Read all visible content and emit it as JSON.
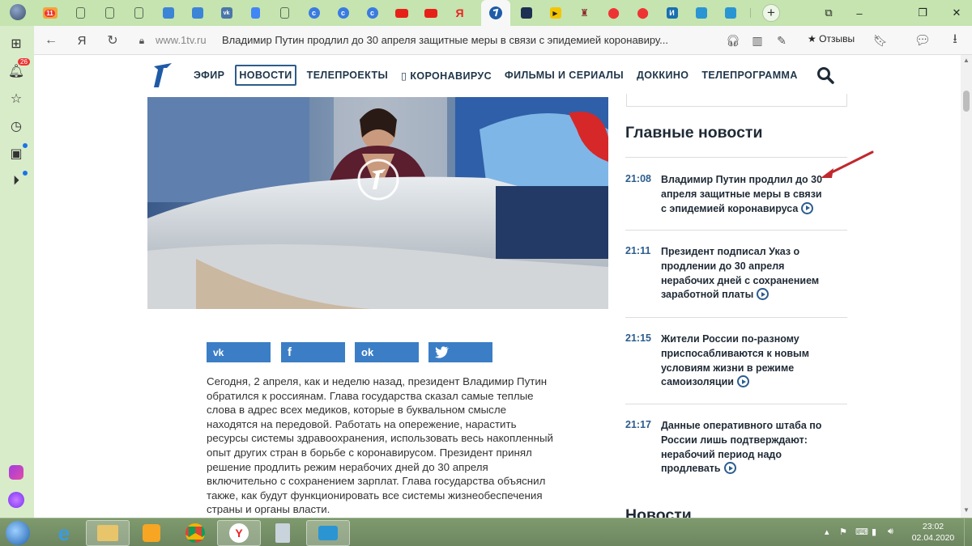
{
  "browser": {
    "tab_badge": "11",
    "tab_letter_ya": "Я",
    "new_tab_glyph": "+",
    "notifications_badge": "26",
    "address": {
      "host": "www.1tv.ru",
      "page_title": "Владимир Путин продлил до 30 апреля защитные меры в связи с эпидемией коронавиру...",
      "yandex_glyph": "Я",
      "reviews_label": "Отзывы"
    }
  },
  "site": {
    "nav": [
      "ЭФИР",
      "НОВОСТИ",
      "ТЕЛЕПРОЕКТЫ",
      "▯ КОРОНАВИРУС",
      "ФИЛЬМЫ И СЕРИАЛЫ",
      "ДОККИНО",
      "ТЕЛЕПРОГРАММА"
    ],
    "active_nav": "НОВОСТИ",
    "share": [
      "vk",
      "facebook",
      "odnoklassniki",
      "twitter"
    ],
    "article_text": "Сегодня, 2 апреля, как и неделю назад, президент Владимир Путин обратился к россиянам. Глава государства сказал самые теплые слова в адрес всех медиков, которые в буквальном смысле находятся на передовой. Работать на опережение, нарастить ресурсы системы здравоохранения, использовать весь накопленный опыт других стран в борьбе с коронавирусом. Президент принял решение продлить режим нерабочих дней до 30 апреля включительно с сохранением зарплат. Глава государства объяснил также, как будут функционировать все системы жизнеобеспечения страны и органы власти.",
    "sidebar": {
      "title": "Главные новости",
      "news": [
        {
          "time": "21:08",
          "headline": "Владимир Путин продлил до 30 апреля защитные меры в связи с эпидемией коронавируса"
        },
        {
          "time": "21:11",
          "headline": "Президент подписал Указ о продлении до 30 апреля нерабочих дней с сохранением заработной платы"
        },
        {
          "time": "21:15",
          "headline": "Жители России по-разному приспосабливаются к новым условиям жизни в режиме самоизоляции"
        },
        {
          "time": "21:17",
          "headline": "Данные оперативного штаба по России лишь подтверждают: нерабочий период надо продлевать"
        }
      ],
      "next_section": "Новости"
    }
  },
  "taskbar": {
    "time": "23:02",
    "date": "02.04.2020"
  },
  "colors": {
    "accent": "#2c5d8f",
    "share": "#3b7ec6",
    "arrow": "#c0282e"
  }
}
